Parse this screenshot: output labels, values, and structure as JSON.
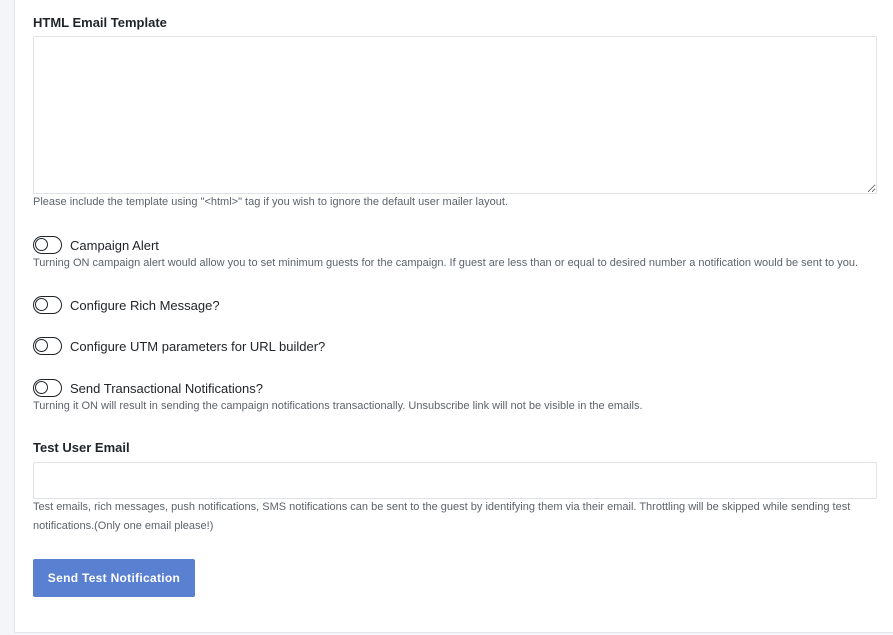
{
  "template": {
    "label": "HTML Email Template",
    "value": "",
    "help": "Please include the template using \"<html>\" tag if you wish to ignore the default user mailer layout."
  },
  "toggles": [
    {
      "label": "Campaign Alert",
      "state": "off",
      "help": "Turning ON campaign alert would allow you to set minimum guests for the campaign. If guest are less than or equal to desired number a notification would be sent to you."
    },
    {
      "label": "Configure Rich Message?",
      "state": "off"
    },
    {
      "label": "Configure UTM parameters for URL builder?",
      "state": "off"
    },
    {
      "label": "Send Transactional Notifications?",
      "state": "off",
      "help": "Turning it ON will result in sending the campaign notifications transactionally. Unsubscribe link will not be visible in the emails."
    }
  ],
  "test_email": {
    "label": "Test User Email",
    "value": "",
    "help_line1": "Test emails, rich messages, push notifications, SMS notifications can be sent to the guest by identifying them via their email. Throttling will be skipped while sending test",
    "help_line2": "notifications.(Only one email please!)"
  },
  "send_button_label": "Send Test Notification",
  "colors": {
    "primary_button": "#5a80d1",
    "background": "#f4f5f8",
    "border": "#dfe2e6"
  }
}
